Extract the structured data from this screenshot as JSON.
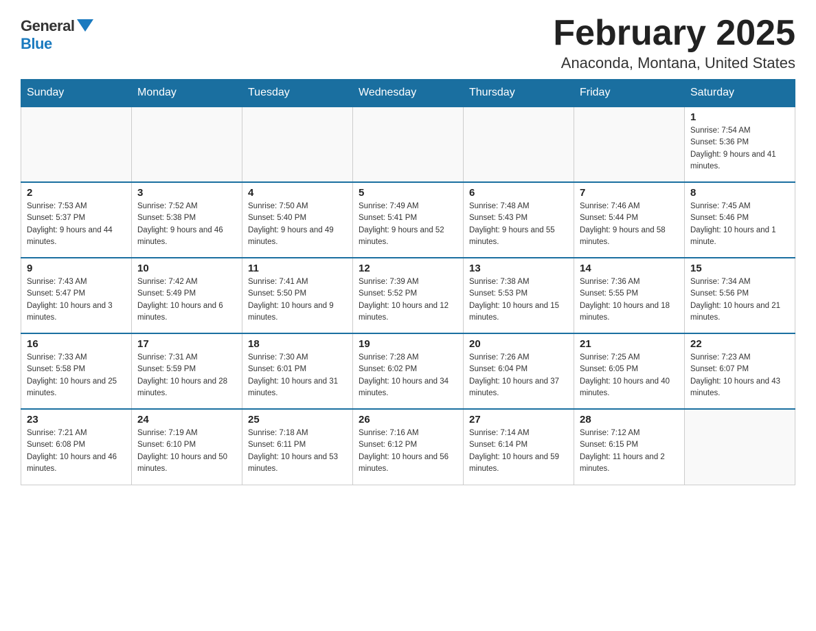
{
  "header": {
    "logo_general": "General",
    "logo_blue": "Blue",
    "title": "February 2025",
    "subtitle": "Anaconda, Montana, United States"
  },
  "weekdays": [
    "Sunday",
    "Monday",
    "Tuesday",
    "Wednesday",
    "Thursday",
    "Friday",
    "Saturday"
  ],
  "weeks": [
    [
      {
        "day": "",
        "sunrise": "",
        "sunset": "",
        "daylight": ""
      },
      {
        "day": "",
        "sunrise": "",
        "sunset": "",
        "daylight": ""
      },
      {
        "day": "",
        "sunrise": "",
        "sunset": "",
        "daylight": ""
      },
      {
        "day": "",
        "sunrise": "",
        "sunset": "",
        "daylight": ""
      },
      {
        "day": "",
        "sunrise": "",
        "sunset": "",
        "daylight": ""
      },
      {
        "day": "",
        "sunrise": "",
        "sunset": "",
        "daylight": ""
      },
      {
        "day": "1",
        "sunrise": "Sunrise: 7:54 AM",
        "sunset": "Sunset: 5:36 PM",
        "daylight": "Daylight: 9 hours and 41 minutes."
      }
    ],
    [
      {
        "day": "2",
        "sunrise": "Sunrise: 7:53 AM",
        "sunset": "Sunset: 5:37 PM",
        "daylight": "Daylight: 9 hours and 44 minutes."
      },
      {
        "day": "3",
        "sunrise": "Sunrise: 7:52 AM",
        "sunset": "Sunset: 5:38 PM",
        "daylight": "Daylight: 9 hours and 46 minutes."
      },
      {
        "day": "4",
        "sunrise": "Sunrise: 7:50 AM",
        "sunset": "Sunset: 5:40 PM",
        "daylight": "Daylight: 9 hours and 49 minutes."
      },
      {
        "day": "5",
        "sunrise": "Sunrise: 7:49 AM",
        "sunset": "Sunset: 5:41 PM",
        "daylight": "Daylight: 9 hours and 52 minutes."
      },
      {
        "day": "6",
        "sunrise": "Sunrise: 7:48 AM",
        "sunset": "Sunset: 5:43 PM",
        "daylight": "Daylight: 9 hours and 55 minutes."
      },
      {
        "day": "7",
        "sunrise": "Sunrise: 7:46 AM",
        "sunset": "Sunset: 5:44 PM",
        "daylight": "Daylight: 9 hours and 58 minutes."
      },
      {
        "day": "8",
        "sunrise": "Sunrise: 7:45 AM",
        "sunset": "Sunset: 5:46 PM",
        "daylight": "Daylight: 10 hours and 1 minute."
      }
    ],
    [
      {
        "day": "9",
        "sunrise": "Sunrise: 7:43 AM",
        "sunset": "Sunset: 5:47 PM",
        "daylight": "Daylight: 10 hours and 3 minutes."
      },
      {
        "day": "10",
        "sunrise": "Sunrise: 7:42 AM",
        "sunset": "Sunset: 5:49 PM",
        "daylight": "Daylight: 10 hours and 6 minutes."
      },
      {
        "day": "11",
        "sunrise": "Sunrise: 7:41 AM",
        "sunset": "Sunset: 5:50 PM",
        "daylight": "Daylight: 10 hours and 9 minutes."
      },
      {
        "day": "12",
        "sunrise": "Sunrise: 7:39 AM",
        "sunset": "Sunset: 5:52 PM",
        "daylight": "Daylight: 10 hours and 12 minutes."
      },
      {
        "day": "13",
        "sunrise": "Sunrise: 7:38 AM",
        "sunset": "Sunset: 5:53 PM",
        "daylight": "Daylight: 10 hours and 15 minutes."
      },
      {
        "day": "14",
        "sunrise": "Sunrise: 7:36 AM",
        "sunset": "Sunset: 5:55 PM",
        "daylight": "Daylight: 10 hours and 18 minutes."
      },
      {
        "day": "15",
        "sunrise": "Sunrise: 7:34 AM",
        "sunset": "Sunset: 5:56 PM",
        "daylight": "Daylight: 10 hours and 21 minutes."
      }
    ],
    [
      {
        "day": "16",
        "sunrise": "Sunrise: 7:33 AM",
        "sunset": "Sunset: 5:58 PM",
        "daylight": "Daylight: 10 hours and 25 minutes."
      },
      {
        "day": "17",
        "sunrise": "Sunrise: 7:31 AM",
        "sunset": "Sunset: 5:59 PM",
        "daylight": "Daylight: 10 hours and 28 minutes."
      },
      {
        "day": "18",
        "sunrise": "Sunrise: 7:30 AM",
        "sunset": "Sunset: 6:01 PM",
        "daylight": "Daylight: 10 hours and 31 minutes."
      },
      {
        "day": "19",
        "sunrise": "Sunrise: 7:28 AM",
        "sunset": "Sunset: 6:02 PM",
        "daylight": "Daylight: 10 hours and 34 minutes."
      },
      {
        "day": "20",
        "sunrise": "Sunrise: 7:26 AM",
        "sunset": "Sunset: 6:04 PM",
        "daylight": "Daylight: 10 hours and 37 minutes."
      },
      {
        "day": "21",
        "sunrise": "Sunrise: 7:25 AM",
        "sunset": "Sunset: 6:05 PM",
        "daylight": "Daylight: 10 hours and 40 minutes."
      },
      {
        "day": "22",
        "sunrise": "Sunrise: 7:23 AM",
        "sunset": "Sunset: 6:07 PM",
        "daylight": "Daylight: 10 hours and 43 minutes."
      }
    ],
    [
      {
        "day": "23",
        "sunrise": "Sunrise: 7:21 AM",
        "sunset": "Sunset: 6:08 PM",
        "daylight": "Daylight: 10 hours and 46 minutes."
      },
      {
        "day": "24",
        "sunrise": "Sunrise: 7:19 AM",
        "sunset": "Sunset: 6:10 PM",
        "daylight": "Daylight: 10 hours and 50 minutes."
      },
      {
        "day": "25",
        "sunrise": "Sunrise: 7:18 AM",
        "sunset": "Sunset: 6:11 PM",
        "daylight": "Daylight: 10 hours and 53 minutes."
      },
      {
        "day": "26",
        "sunrise": "Sunrise: 7:16 AM",
        "sunset": "Sunset: 6:12 PM",
        "daylight": "Daylight: 10 hours and 56 minutes."
      },
      {
        "day": "27",
        "sunrise": "Sunrise: 7:14 AM",
        "sunset": "Sunset: 6:14 PM",
        "daylight": "Daylight: 10 hours and 59 minutes."
      },
      {
        "day": "28",
        "sunrise": "Sunrise: 7:12 AM",
        "sunset": "Sunset: 6:15 PM",
        "daylight": "Daylight: 11 hours and 2 minutes."
      },
      {
        "day": "",
        "sunrise": "",
        "sunset": "",
        "daylight": ""
      }
    ]
  ]
}
